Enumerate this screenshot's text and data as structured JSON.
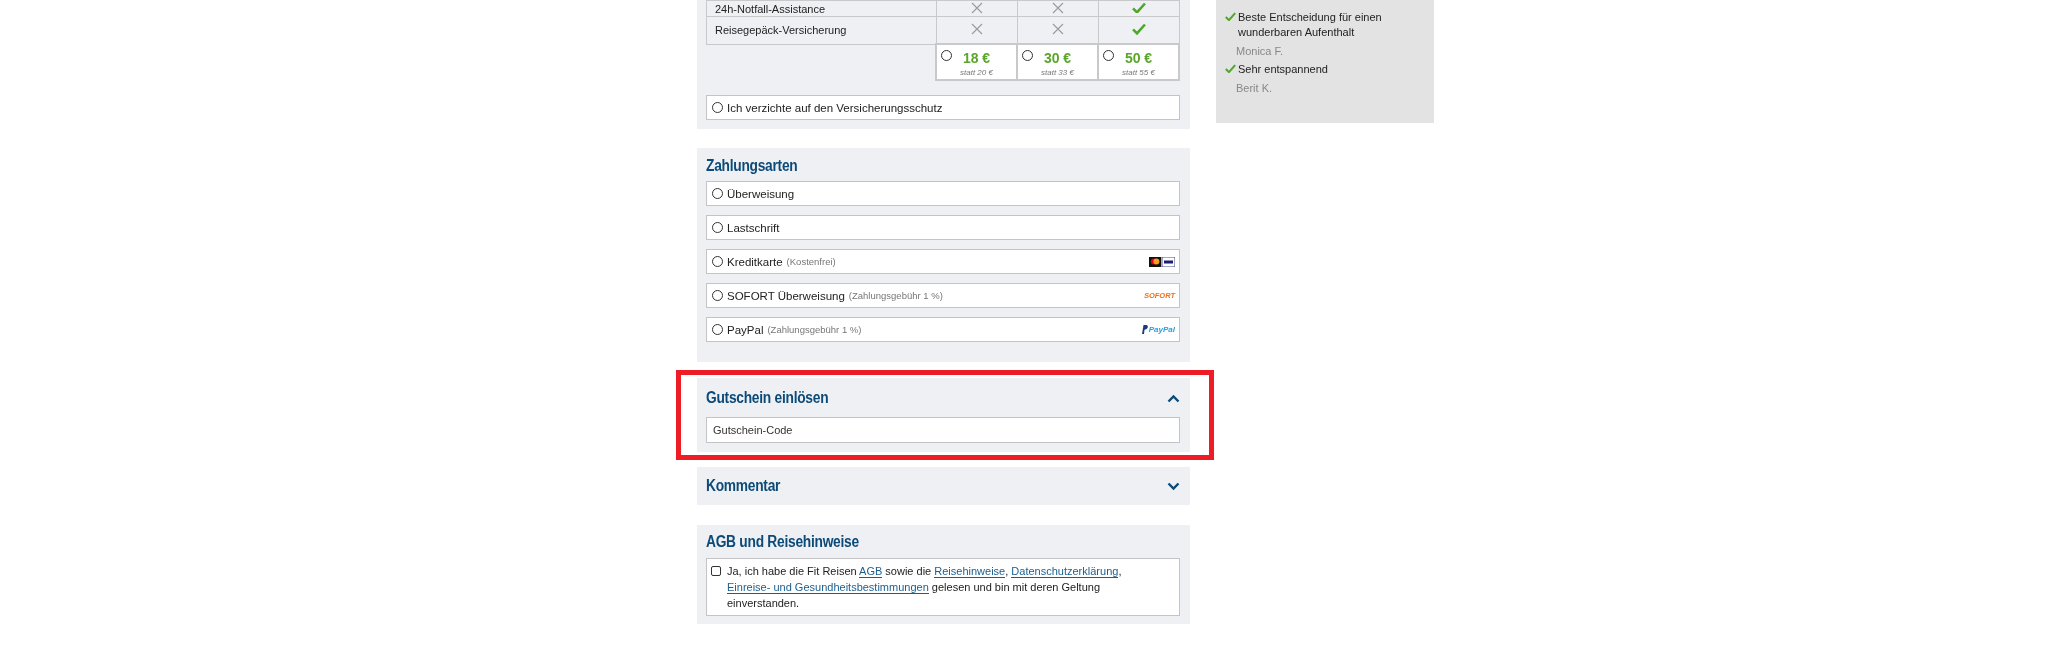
{
  "insurance": {
    "rows": [
      {
        "label": "24h-Notfall-Assistance",
        "cells": [
          {
            "kind": "cross"
          },
          {
            "kind": "cross"
          },
          {
            "kind": "check"
          }
        ]
      },
      {
        "label": "Reisegepäck-Versicherung",
        "cells": [
          {
            "kind": "cross"
          },
          {
            "kind": "cross"
          },
          {
            "kind": "check"
          }
        ]
      }
    ],
    "plans": [
      {
        "price": "18 €",
        "old_price": "statt 20 €",
        "selected": false
      },
      {
        "price": "30 €",
        "old_price": "statt 33 €",
        "selected": false
      },
      {
        "price": "50 €",
        "old_price": "statt 55 €",
        "selected": false
      }
    ],
    "decline": {
      "label": "Ich verzichte auf den Versicherungsschutz",
      "selected": false
    }
  },
  "payments": {
    "title": "Zahlungsarten",
    "options": [
      {
        "label": "Überweisung",
        "selected": false
      },
      {
        "label": "Lastschrift",
        "selected": false
      },
      {
        "label": "Kreditkarte",
        "note": "(Kostenfrei)",
        "selected": false,
        "logo": {
          "kind": "cards"
        }
      },
      {
        "label": "SOFORT Überweisung",
        "note": "(Zahlungsgebühr 1 %)",
        "selected": false,
        "logo": {
          "kind": "sofort",
          "text": "SOFORT"
        }
      },
      {
        "label": "PayPal",
        "note": "(Zahlungsgebühr 1 %)",
        "selected": false,
        "logo": {
          "kind": "paypal",
          "text": "PayPal"
        }
      }
    ]
  },
  "voucher": {
    "title": "Gutschein einlösen",
    "expanded": true,
    "highlighted": true,
    "placeholder": "Gutschein-Code"
  },
  "comment": {
    "title": "Kommentar",
    "expanded": false
  },
  "terms": {
    "title": "AGB und Reisehinweise",
    "checked": false,
    "parts": [
      {
        "text": "Ja, ich habe die Fit Reisen "
      },
      {
        "text": "AGB",
        "link": true
      },
      {
        "text": " sowie die "
      },
      {
        "text": "Reisehinweise",
        "link": true
      },
      {
        "text": ", "
      },
      {
        "text": "Datenschutzerklärung",
        "link": true
      },
      {
        "text": ", "
      },
      {
        "text": "Einreise- und Gesundheitsbestimmungen",
        "link": true
      },
      {
        "text": " gelesen und bin mit deren Geltung einverstanden."
      }
    ]
  },
  "reviews": [
    {
      "quote": "Beste Entscheidung für einen wunderbaren Aufenthalt",
      "author": "Monica F."
    },
    {
      "quote": "Sehr entspannend",
      "author": "Berit K."
    }
  ]
}
